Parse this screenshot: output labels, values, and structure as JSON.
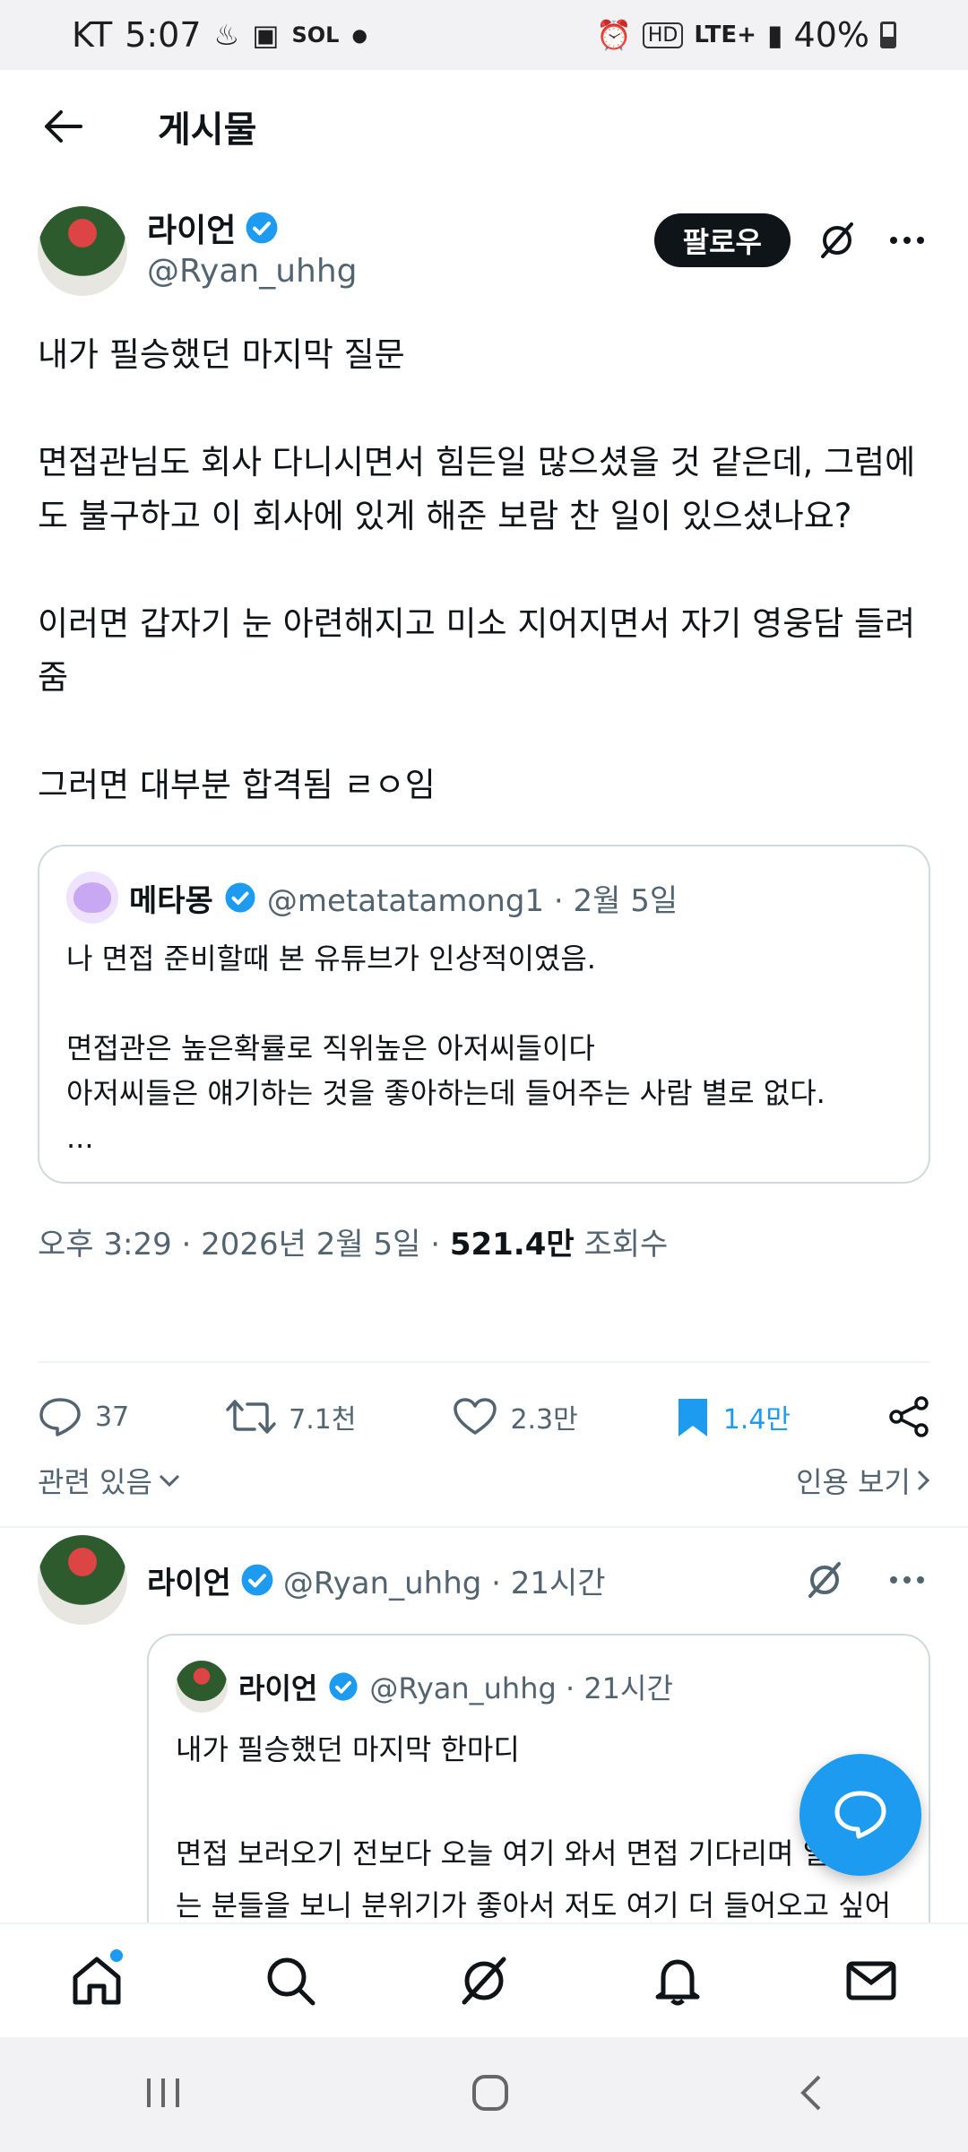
{
  "status_bar": {
    "carrier": "KT",
    "time": "5:07",
    "network": "LTE+",
    "battery": "40%",
    "hd": "HD"
  },
  "header": {
    "title": "게시물"
  },
  "post": {
    "author_name": "라이언",
    "handle": "@Ryan_uhhg",
    "follow_label": "팔로우",
    "text": "내가 필승했던 마지막 질문\n\n면접관님도 회사 다니시면서 힘든일 많으셨을 것 같은데, 그럼에도 불구하고 이 회사에 있게 해준 보람 찬 일이 있으셨나요?\n\n이러면 갑자기 눈 아련해지고 미소 지어지면서 자기 영웅담 들려줌\n\n그러면 대부분 합격됨 ㄹㅇ임",
    "quote": {
      "author_name": "메타몽",
      "handle_date": "@metatatamong1 · 2월 5일",
      "text": "나 면접 준비할때 본 유튜브가 인상적이였음.\n\n면접관은 높은확률로 직위높은 아저씨들이다\n아저씨들은 얘기하는 것을 좋아하는데 들어주는 사람 별로 없다.\n..."
    },
    "timestamp": "오후 3:29 · 2026년 2월 5일 · ",
    "views": "521.4만",
    "views_label": " 조회수"
  },
  "actions": {
    "replies": "37",
    "reposts": "7.1천",
    "likes": "2.3만",
    "bookmarks": "1.4만"
  },
  "related": {
    "left": "관련 있음",
    "right": "인용 보기"
  },
  "reply": {
    "author_name": "라이언",
    "handle_time": "@Ryan_uhhg · 21시간",
    "quote": {
      "author_name": "라이언",
      "handle_time": "@Ryan_uhhg · 21시간",
      "text": "내가 필승했던 마지막 한마디\n\n면접 보러오기 전보다 오늘 여기 와서 면접 기다리며 일하시는 분들을 보니 분위기가 좋아서 저도 여기 더 들어오고 싶어졌습니다"
    }
  },
  "colors": {
    "accent": "#1d9bf0",
    "text": "#0f1419",
    "muted": "#536471"
  }
}
